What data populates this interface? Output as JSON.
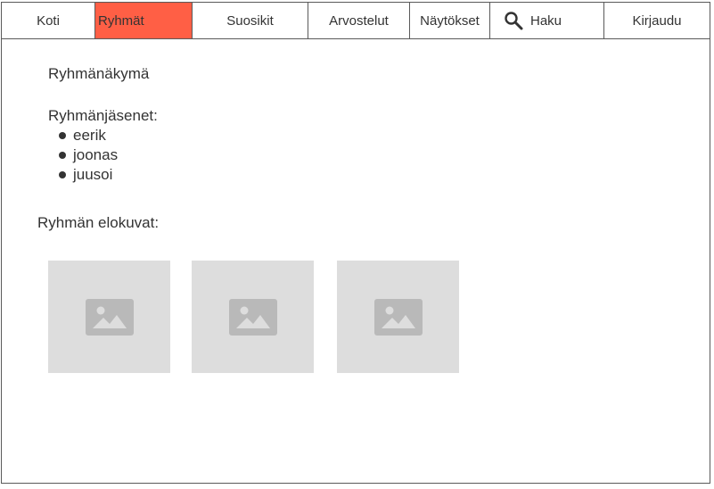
{
  "nav": {
    "items": [
      {
        "label": "Koti",
        "active": false
      },
      {
        "label": "Ryhmät",
        "active": true
      },
      {
        "label": "Suosikit",
        "active": false
      },
      {
        "label": "Arvostelut",
        "active": false
      },
      {
        "label": "Näytökset",
        "active": false
      },
      {
        "label": "Haku",
        "active": false,
        "icon": "search-icon"
      },
      {
        "label": "Kirjaudu",
        "active": false
      }
    ],
    "active_color": "#ff5f45"
  },
  "group": {
    "view_title": "Ryhmänäkymä",
    "members_heading": "Ryhmänjäsenet:",
    "members": [
      "eerik",
      "joonas",
      "juusoi"
    ],
    "movies_heading": "Ryhmän elokuvat:",
    "movies": [
      {
        "icon": "image-placeholder-icon"
      },
      {
        "icon": "image-placeholder-icon"
      },
      {
        "icon": "image-placeholder-icon"
      }
    ]
  }
}
